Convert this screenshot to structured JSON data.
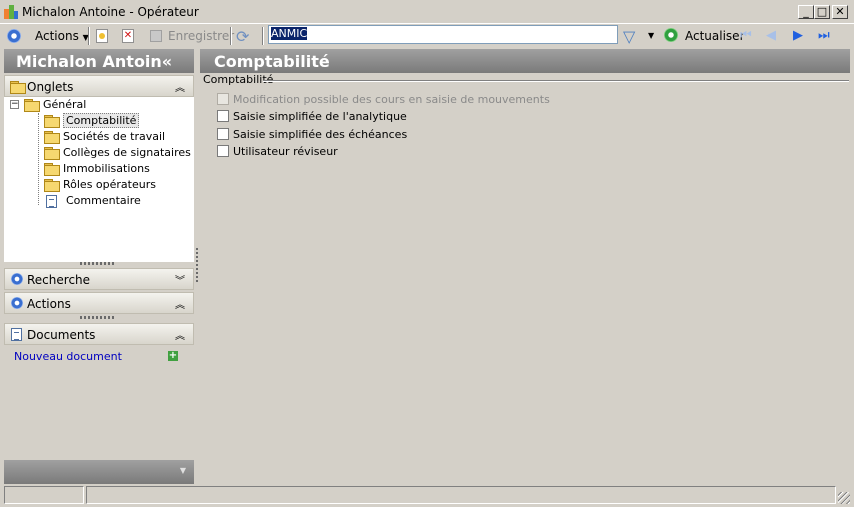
{
  "window": {
    "title": "Michalon Antoine - Opérateur",
    "controls": [
      "_",
      "□",
      "✕"
    ]
  },
  "toolbar": {
    "actions_label": "Actions",
    "save_label": "Enregistrer",
    "search_value": "ANMIC",
    "refresh_label": "Actualiser"
  },
  "left": {
    "header": "Michalon Antoin«",
    "onglets_label": "Onglets",
    "tree": {
      "root": "Général",
      "children": [
        "Comptabilité",
        "Sociétés de travail",
        "Collèges de signataires",
        "Immobilisations",
        "Rôles opérateurs",
        "Commentaire"
      ]
    },
    "recherche_label": "Recherche",
    "actions_label": "Actions",
    "documents_label": "Documents",
    "new_document_label": "Nouveau document"
  },
  "right": {
    "header": "Comptabilité",
    "group_label": "Comptabilité",
    "options": [
      {
        "label": "Modification possible des cours en saisie de mouvements",
        "checked": false,
        "enabled": false
      },
      {
        "label": "Saisie simplifiée de l'analytique",
        "checked": false,
        "enabled": true
      },
      {
        "label": "Saisie simplifiée des échéances",
        "checked": false,
        "enabled": true
      },
      {
        "label": "Utilisateur réviseur",
        "checked": false,
        "enabled": true
      }
    ]
  },
  "colors": {
    "link": "#0000c0",
    "panel_header": "#8c8c8c",
    "window_bg": "#d4d0c8"
  }
}
